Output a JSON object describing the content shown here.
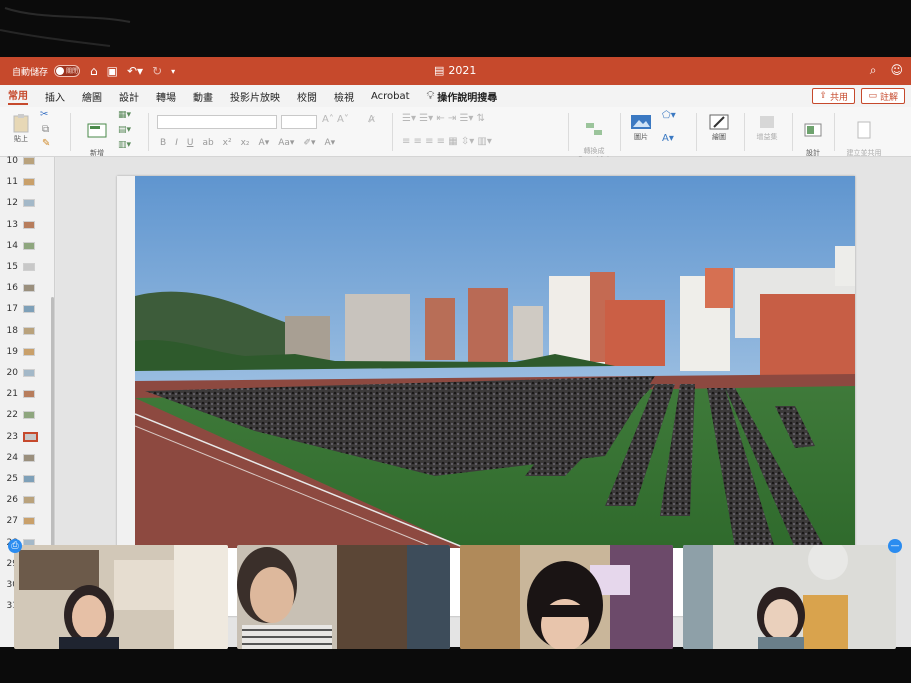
{
  "titlebar": {
    "autosave_label": "自動儲存",
    "autosave_state": "關閉",
    "document_title": "2021",
    "accent_color": "#c6492c"
  },
  "tabs": [
    {
      "label": "常用",
      "active": true
    },
    {
      "label": "插入",
      "active": false
    },
    {
      "label": "繪圖",
      "active": false
    },
    {
      "label": "設計",
      "active": false
    },
    {
      "label": "轉場",
      "active": false
    },
    {
      "label": "動畫",
      "active": false
    },
    {
      "label": "投影片放映",
      "active": false
    },
    {
      "label": "校閱",
      "active": false
    },
    {
      "label": "檢視",
      "active": false
    },
    {
      "label": "Acrobat",
      "active": false
    }
  ],
  "tellme": {
    "label": "操作說明搜尋",
    "icon": "lightbulb-icon"
  },
  "share": {
    "label": "共用",
    "icon": "share-icon"
  },
  "comments": {
    "label": "註解",
    "icon": "comment-icon"
  },
  "ribbon": {
    "paste_label": "貼上",
    "new_slide_label": "新增\n投影片",
    "convert_smartart_label": "轉換成\nSmartArt",
    "picture_label": "圖片",
    "drawing_label": "繪圖",
    "addins_label": "增益集",
    "design_ideas_label": "設計\n構想",
    "create_pdf_label": "建立並共用\nAdobe PDF"
  },
  "thumbnails": {
    "numbers": [
      "10",
      "11",
      "12",
      "13",
      "14",
      "15",
      "16",
      "17",
      "18",
      "19",
      "20",
      "21",
      "22",
      "23",
      "24",
      "25",
      "26",
      "27",
      "28",
      "29",
      "30",
      "31"
    ],
    "selected": "23"
  },
  "video_participants": [
    "participant-1",
    "participant-2",
    "participant-3",
    "participant-4"
  ]
}
